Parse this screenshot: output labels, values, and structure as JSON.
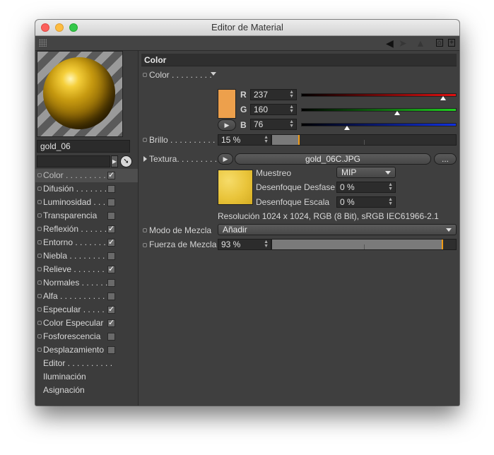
{
  "window": {
    "title": "Editor de Material"
  },
  "material": {
    "name": "gold_06"
  },
  "channels": [
    {
      "label": "Color . . . . . . . . .",
      "checked": true,
      "has_checkbox": true,
      "active": true
    },
    {
      "label": "Difusión . . . . . . .",
      "checked": false,
      "has_checkbox": true
    },
    {
      "label": "Luminosidad . . . .",
      "checked": false,
      "has_checkbox": true
    },
    {
      "label": "Transparencia",
      "checked": false,
      "has_checkbox": true
    },
    {
      "label": "Reflexión . . . . . .",
      "checked": true,
      "has_checkbox": true
    },
    {
      "label": "Entorno . . . . . . .",
      "checked": true,
      "has_checkbox": true
    },
    {
      "label": "Niebla . . . . . . . . .",
      "checked": false,
      "has_checkbox": true
    },
    {
      "label": "Relieve . . . . . . . .",
      "checked": true,
      "has_checkbox": true
    },
    {
      "label": "Normales . . . . . .",
      "checked": false,
      "has_checkbox": true
    },
    {
      "label": "Alfa . . . . . . . . . . . .",
      "checked": false,
      "has_checkbox": true
    },
    {
      "label": "Especular . . . . . .",
      "checked": true,
      "has_checkbox": true
    },
    {
      "label": "Color Especular",
      "checked": true,
      "has_checkbox": true
    },
    {
      "label": "Fosforescencia",
      "checked": false,
      "has_checkbox": true
    },
    {
      "label": "Desplazamiento",
      "checked": false,
      "has_checkbox": true
    },
    {
      "label": "Editor . . . . . . . . . .",
      "has_checkbox": false
    },
    {
      "label": "Iluminación",
      "has_checkbox": false
    },
    {
      "label": "Asignación",
      "has_checkbox": false
    }
  ],
  "color_section": {
    "header": "Color",
    "color_label": "Color . . . . . . . . .",
    "swatch_color": "#eda04c",
    "r_label": "R",
    "r_value": "237",
    "r_level": 0.93,
    "g_label": "G",
    "g_value": "160",
    "g_level": 0.63,
    "b_label": "B",
    "b_value": "76",
    "b_level": 0.3,
    "brightness_label": "Brillo . . . . . . . . . . .",
    "brightness_value": "15 %",
    "brightness_level": 0.15,
    "texture_label": "Textura. . . . . . . . . .",
    "texture_file": "gold_06C.JPG",
    "texture_more": "...",
    "sampling_label": "Muestreo",
    "sampling_value": "MIP",
    "blur_offset_label": "Desenfoque Desfase",
    "blur_offset_value": "0 %",
    "blur_scale_label": "Desenfoque Escala",
    "blur_scale_value": "0 %",
    "resolution_info": "Resolución 1024 x 1024, RGB (8 Bit), sRGB IEC61966-2.1",
    "blend_mode_label": "Modo de Mezcla",
    "blend_mode_value": "Añadir",
    "blend_strength_label": "Fuerza de Mezcla",
    "blend_strength_value": "93 %",
    "blend_strength_level": 0.93
  },
  "icons": {
    "grip": "grip-icon",
    "back": "arrow-left-icon",
    "lock": "lock-icon",
    "new": "new-window-icon"
  }
}
